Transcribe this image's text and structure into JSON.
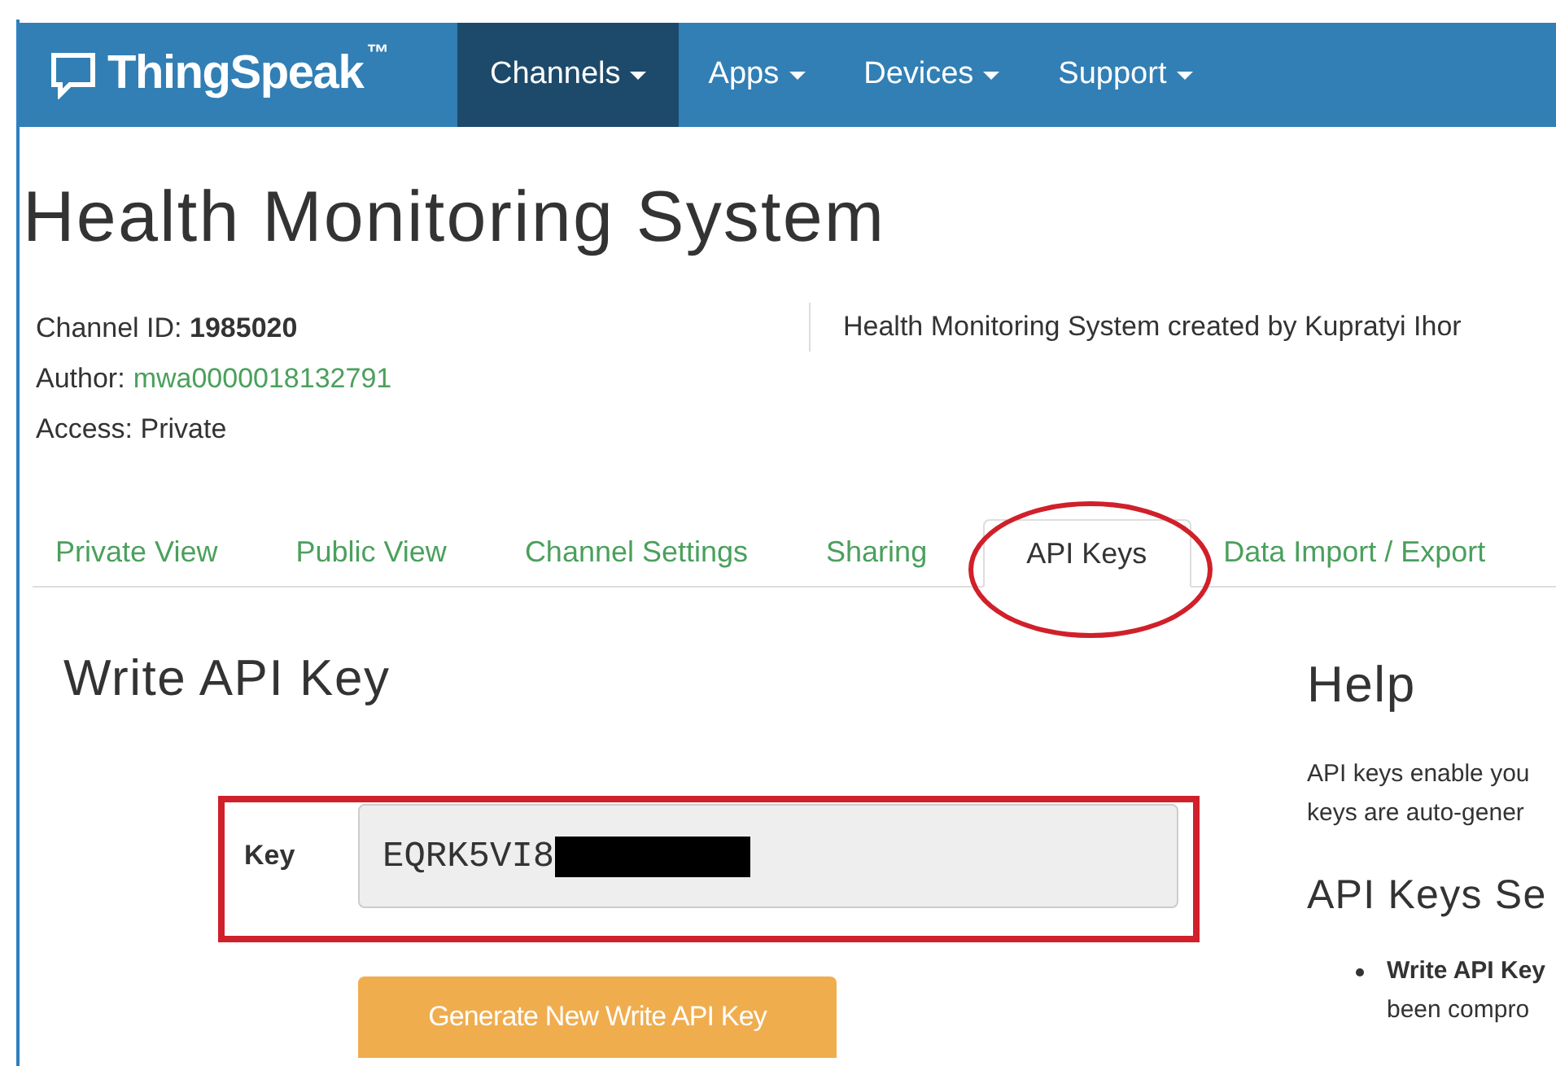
{
  "nav": {
    "brand": "ThingSpeak",
    "trademark": "™",
    "items": [
      {
        "label": "Channels",
        "selected": true
      },
      {
        "label": "Apps",
        "selected": false
      },
      {
        "label": "Devices",
        "selected": false
      },
      {
        "label": "Support",
        "selected": false
      }
    ]
  },
  "page_title": "Health Monitoring System",
  "channel_info": {
    "id_label": "Channel ID:",
    "id": "1985020",
    "author_label": "Author:",
    "author": "mwa0000018132791",
    "access": "Access: Private"
  },
  "description": "Health Monitoring System created by Kupratyi Ihor",
  "tabs": [
    {
      "label": "Private View",
      "selected": false
    },
    {
      "label": "Public View",
      "selected": false
    },
    {
      "label": "Channel Settings",
      "selected": false
    },
    {
      "label": "Sharing",
      "selected": false
    },
    {
      "label": "API Keys",
      "selected": true
    },
    {
      "label": "Data Import / Export",
      "selected": false
    }
  ],
  "write_key": {
    "heading": "Write API Key",
    "label": "Key",
    "value": "EQRK5VI8",
    "redacted": true,
    "button": "Generate New Write API Key"
  },
  "help": {
    "heading": "Help",
    "lines": [
      "API keys enable you",
      "keys are auto-gener"
    ],
    "subheading": "API Keys Se",
    "bullet_title": "Write API Key",
    "bullet_text": "been compro"
  },
  "annotations": [
    {
      "kind": "ellipse"
    },
    {
      "kind": "rectangle"
    }
  ]
}
